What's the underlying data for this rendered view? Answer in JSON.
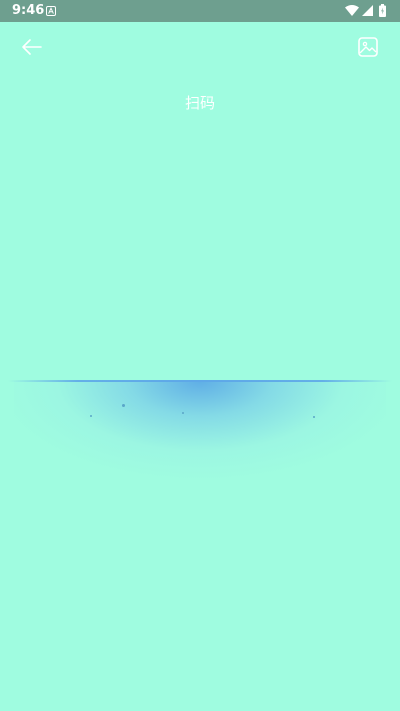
{
  "status_bar": {
    "time": "9:46",
    "icons": [
      "notification-a-icon",
      "wifi-icon",
      "signal-icon",
      "battery-icon"
    ],
    "background": "#6e9f8f"
  },
  "toolbar": {
    "back_icon": "arrow-left-icon",
    "gallery_icon": "image-icon"
  },
  "page": {
    "title": "扫码",
    "background": "#9ffce0"
  },
  "scanner": {
    "scan_line_color": "#5ea8e8"
  }
}
